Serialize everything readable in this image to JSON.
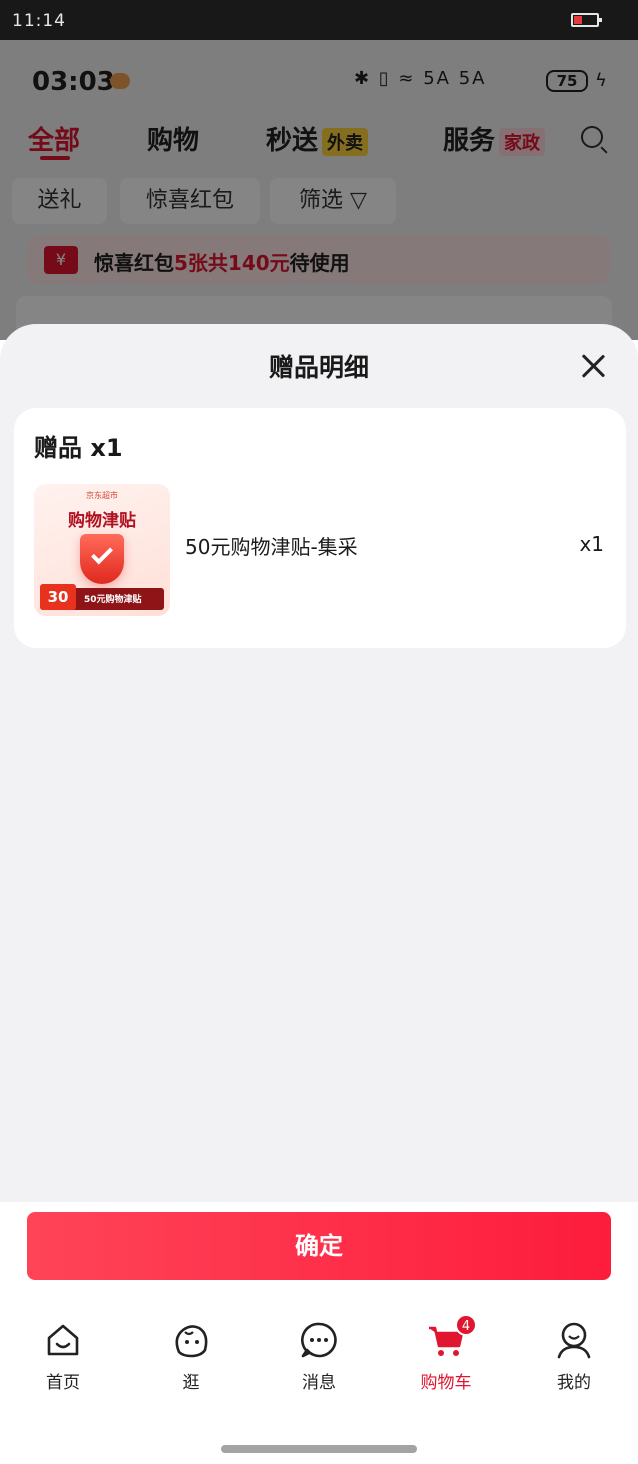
{
  "system_status": {
    "time": "11:14"
  },
  "background_page": {
    "status_time": "03:03",
    "status_icons": "✱ ▯ ≈ 5A 5A",
    "battery_level": "75",
    "category_tabs": [
      {
        "label": "全部",
        "active": true
      },
      {
        "label": "购物",
        "active": false
      },
      {
        "label": "秒送",
        "tag": "外卖",
        "active": false
      },
      {
        "label": "服务",
        "tag": "家政",
        "active": false
      }
    ],
    "filter_chips": [
      "送礼",
      "惊喜红包",
      "筛选"
    ],
    "voucher_bar": {
      "prefix": "惊喜红包",
      "highlight": "5张共140元",
      "suffix": "待使用",
      "icon_symbol": "¥"
    }
  },
  "sheet": {
    "title": "赠品明细",
    "gift_section": {
      "heading": "赠品 x1",
      "items": [
        {
          "name": "50元购物津贴-集采",
          "qty": "x1",
          "thumbnail": {
            "brand": "京东超市",
            "title": "购物津贴",
            "badge_num": "30",
            "badge_text": "50元购物津贴"
          }
        }
      ]
    },
    "confirm_label": "确定"
  },
  "bottom_nav": {
    "items": [
      {
        "label": "首页",
        "icon": "home-icon",
        "active": false
      },
      {
        "label": "逛",
        "icon": "discover-icon",
        "active": false
      },
      {
        "label": "消息",
        "icon": "message-icon",
        "active": false
      },
      {
        "label": "购物车",
        "icon": "cart-icon",
        "active": true,
        "badge": "4"
      },
      {
        "label": "我的",
        "icon": "profile-icon",
        "active": false
      }
    ]
  },
  "colors": {
    "accent": "#e01530",
    "confirm_start": "#ff4458",
    "confirm_end": "#fd1c3c",
    "sheet_bg": "#f2f2f4"
  }
}
